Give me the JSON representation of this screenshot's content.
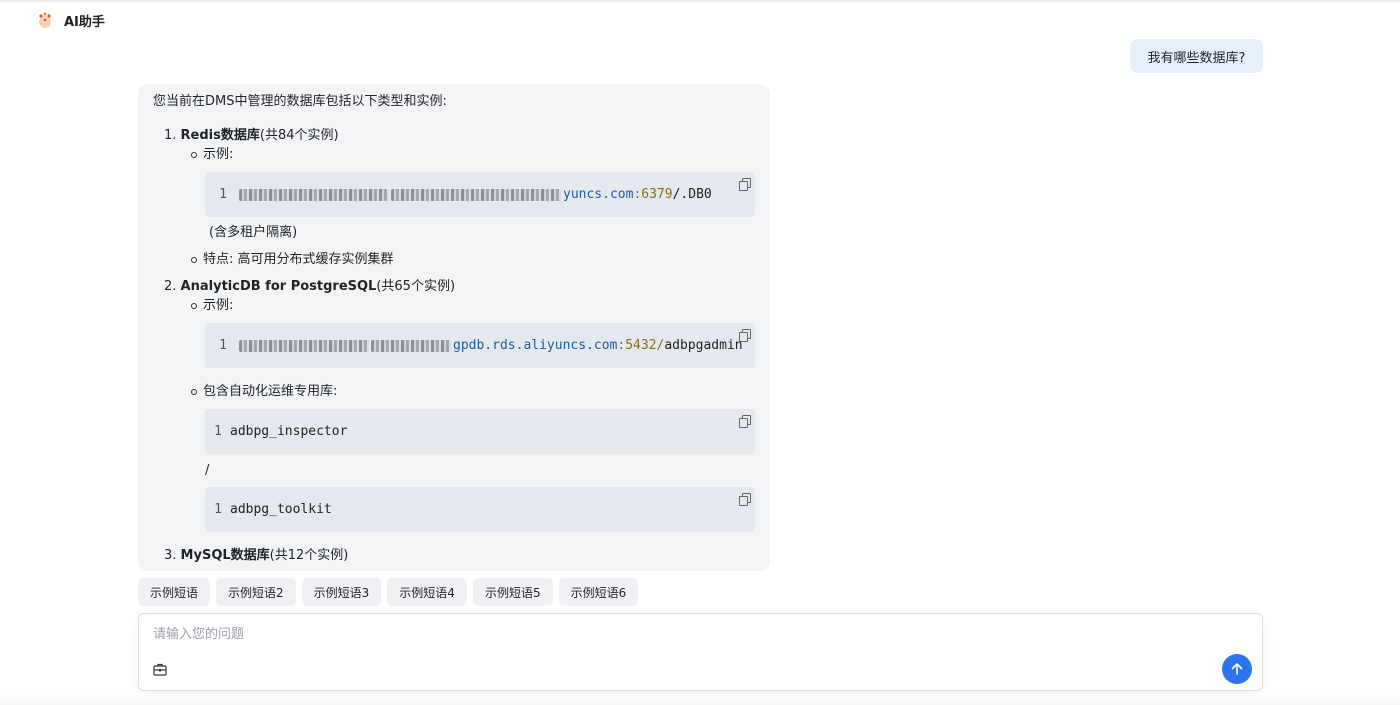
{
  "header": {
    "title": "AI助手",
    "logo_icon": "fire-logo-icon"
  },
  "user_message": "我有哪些数据库?",
  "answer": {
    "intro": "您当前在DMS中管理的数据库包括以下类型和实例:",
    "items": [
      {
        "num": "1.",
        "title": "Redis数据库",
        "count": "(共84个实例)",
        "example_label": "示例:",
        "code_line": "1",
        "code_host": "yuncs.com",
        "code_port": ":6379",
        "code_tail": "/.DB0",
        "note": "(含多租户隔离)",
        "feature": "特点: 高可用分布式缓存实例集群"
      },
      {
        "num": "2.",
        "title": "AnalyticDB for PostgreSQL",
        "count": "(共65个实例)",
        "example_label": "示例:",
        "code_line": "1",
        "code_host": "gpdb.rds.aliyuncs.com",
        "code_port": ":5432/",
        "code_tail": "adbpgadmin",
        "sub_label": "包含自动化运维专用库:",
        "lib1_line": "1",
        "lib1": "adbpg_inspector",
        "separator": "/",
        "lib2_line": "1",
        "lib2": "adbpg_toolkit"
      },
      {
        "num": "3.",
        "title": "MySQL数据库",
        "count": "(共12个实例)"
      }
    ]
  },
  "chips": [
    "示例短语",
    "示例短语2",
    "示例短语3",
    "示例短语4",
    "示例短语5",
    "示例短语6"
  ],
  "input": {
    "placeholder": "请输入您的问题",
    "value": ""
  },
  "colors": {
    "accent": "#2d74f0",
    "user_bubble": "#e6f0fa",
    "answer_bg": "#f3f4f6",
    "code_bg": "#e4e8ef"
  },
  "icons": {
    "copy": "copy-icon",
    "toolbox": "toolbox-icon",
    "send": "arrow-up-icon"
  }
}
